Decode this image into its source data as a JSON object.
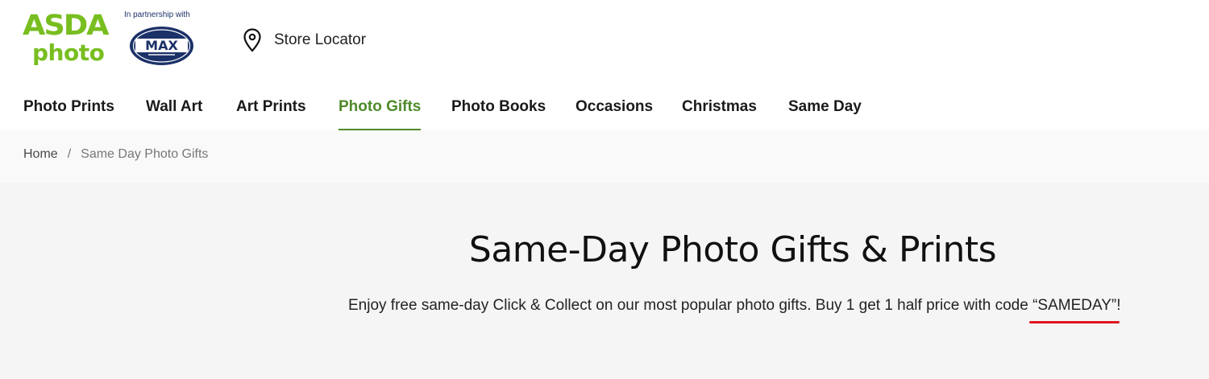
{
  "header": {
    "logo": {
      "brand": "ASDA",
      "sub": "photo"
    },
    "partner_text": "In partnership with",
    "partner_logo_text": "MAX",
    "store_locator": {
      "icon": "map-pin-icon",
      "label": "Store Locator"
    }
  },
  "nav": {
    "items": [
      {
        "label": "Photo Prints",
        "active": false
      },
      {
        "label": "Wall Art",
        "active": false
      },
      {
        "label": "Art Prints",
        "active": false
      },
      {
        "label": "Photo Gifts",
        "active": true
      },
      {
        "label": "Photo Books",
        "active": false
      },
      {
        "label": "Occasions",
        "active": false
      },
      {
        "label": "Christmas",
        "active": false
      },
      {
        "label": "Same Day",
        "active": false
      }
    ]
  },
  "breadcrumb": {
    "home": "Home",
    "separator": "/",
    "current": "Same Day Photo Gifts"
  },
  "hero": {
    "title": "Same-Day Photo Gifts & Prints",
    "description_prefix": "Enjoy free same-day Click & Collect on our most popular photo gifts. Buy 1 get 1 half price with code ",
    "promo_code": "“SAMEDAY”",
    "description_suffix": "!"
  },
  "colors": {
    "brand_green": "#78be20",
    "active_nav": "#4f8a2a",
    "partner_navy": "#1b3168",
    "annotation_red": "#e0141e"
  }
}
